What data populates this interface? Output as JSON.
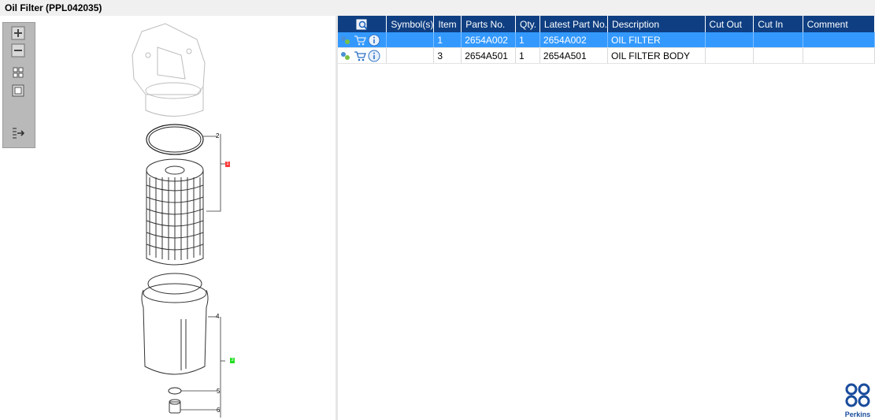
{
  "window": {
    "title": "Oil Filter (PPL042035)"
  },
  "toolbar": {
    "items": [
      {
        "icon": "zoom-in-icon"
      },
      {
        "icon": "zoom-out-icon"
      },
      {
        "icon": "fit-all-icon"
      },
      {
        "icon": "actual-size-icon"
      },
      {
        "icon": "export-list-icon"
      }
    ]
  },
  "drawing": {
    "callouts": [
      "2",
      "1",
      "4",
      "3",
      "5",
      "6"
    ],
    "colors": {
      "highlight_red": "#ff3b3b",
      "highlight_green": "#22dd22"
    }
  },
  "grid": {
    "headers": [
      "",
      "Symbol(s)",
      "Item",
      "Parts No.",
      "Qty.",
      "Latest Part No.",
      "Description",
      "Cut Out",
      "Cut In",
      "Comment"
    ],
    "rows": [
      {
        "selected": true,
        "item": "1",
        "part_no": "2654A002",
        "qty": "1",
        "latest": "2654A002",
        "description": "OIL FILTER",
        "cut_out": "",
        "cut_in": "",
        "comment": ""
      },
      {
        "selected": false,
        "item": "3",
        "part_no": "2654A501",
        "qty": "1",
        "latest": "2654A501",
        "description": "OIL FILTER BODY",
        "cut_out": "",
        "cut_in": "",
        "comment": ""
      }
    ],
    "colors": {
      "header_bg": "#0f3f82",
      "selected_bg": "#3399ff"
    }
  },
  "brand": {
    "name": "Perkins",
    "color": "#1a4c9c"
  }
}
